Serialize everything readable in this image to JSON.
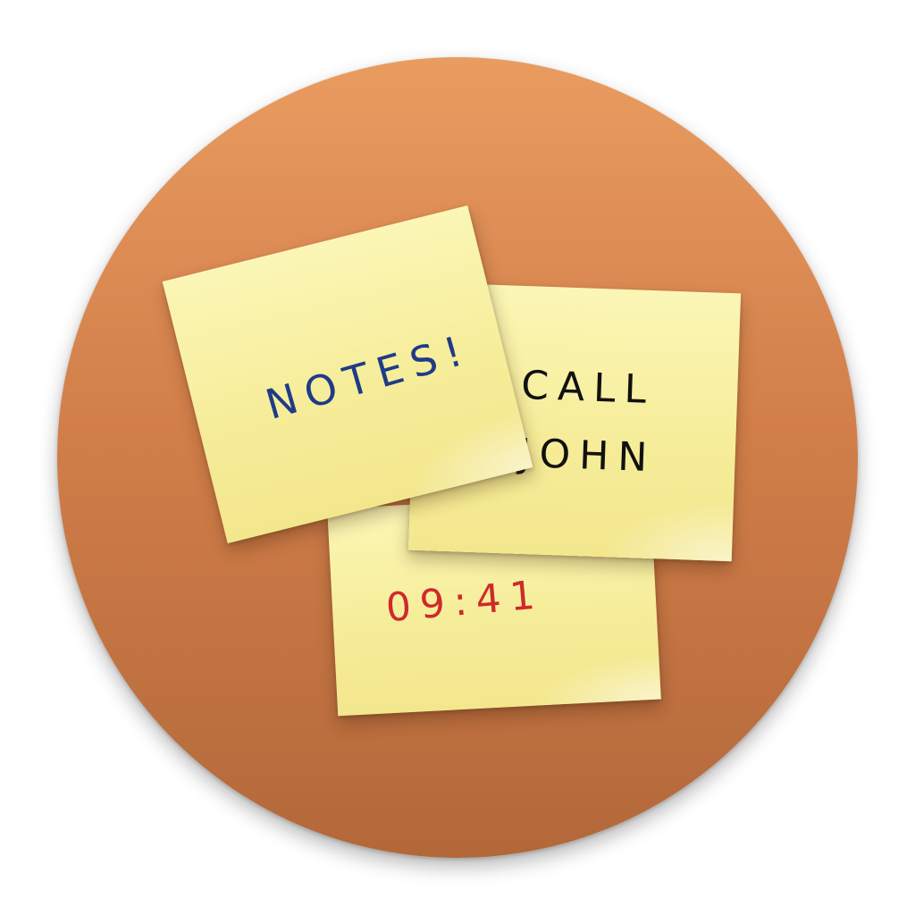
{
  "icon": {
    "name": "Stickies",
    "colors": {
      "disc_top": "#e99c60",
      "disc_bottom": "#b3683a",
      "note_yellow": "#f6ed9a",
      "ink_blue": "#1f3b87",
      "ink_black": "#111111",
      "ink_red": "#cf2a2a"
    },
    "notes": {
      "left": "NOTES!",
      "right_line1": "CALL",
      "right_line2": "JOHN",
      "bottom": "09:41"
    }
  }
}
